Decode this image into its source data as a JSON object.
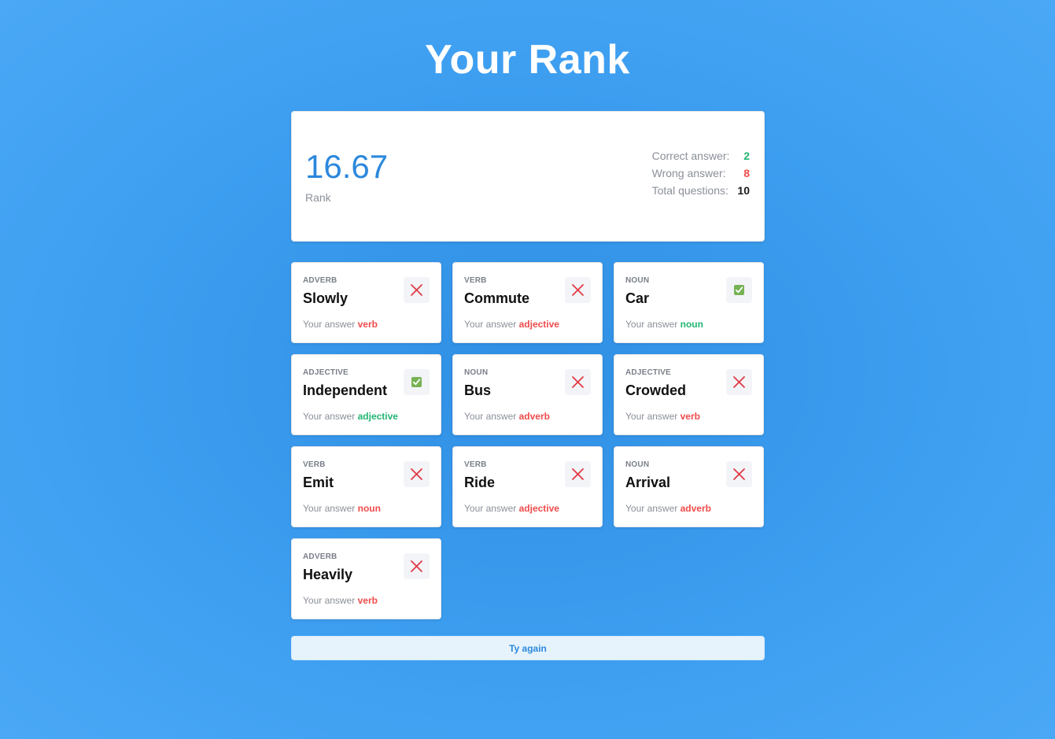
{
  "page": {
    "title": "Your Rank"
  },
  "summary": {
    "score": "16.67",
    "score_label": "Rank",
    "stats": [
      {
        "label": "Correct answer:",
        "value": "2",
        "color": "#22b573"
      },
      {
        "label": "Wrong answer:",
        "value": "8",
        "color": "#f04b4b"
      },
      {
        "label": "Total questions:",
        "value": "10",
        "color": "#1a1a1a"
      }
    ]
  },
  "answer_prefix": "Your answer",
  "results": [
    {
      "category": "ADVERB",
      "word": "Slowly",
      "answer": "verb",
      "correct": false,
      "icon": "x-icon"
    },
    {
      "category": "VERB",
      "word": "Commute",
      "answer": "adjective",
      "correct": false,
      "icon": "x-icon"
    },
    {
      "category": "NOUN",
      "word": "Car",
      "answer": "noun",
      "correct": true,
      "icon": "check-mark-icon"
    },
    {
      "category": "ADJECTIVE",
      "word": "Independent",
      "answer": "adjective",
      "correct": true,
      "icon": "check-mark-icon"
    },
    {
      "category": "NOUN",
      "word": "Bus",
      "answer": "adverb",
      "correct": false,
      "icon": "x-icon"
    },
    {
      "category": "ADJECTIVE",
      "word": "Crowded",
      "answer": "verb",
      "correct": false,
      "icon": "x-icon"
    },
    {
      "category": "VERB",
      "word": "Emit",
      "answer": "noun",
      "correct": false,
      "icon": "x-icon"
    },
    {
      "category": "VERB",
      "word": "Ride",
      "answer": "adjective",
      "correct": false,
      "icon": "x-icon"
    },
    {
      "category": "NOUN",
      "word": "Arrival",
      "answer": "adverb",
      "correct": false,
      "icon": "x-icon"
    },
    {
      "category": "ADVERB",
      "word": "Heavily",
      "answer": "verb",
      "correct": false,
      "icon": "x-icon"
    }
  ],
  "actions": {
    "try_again_label": "Ty again"
  },
  "colors": {
    "accent": "#2c88dc",
    "correct": "#22b573",
    "wrong": "#f04b4b",
    "background": "#3d9ef0"
  }
}
